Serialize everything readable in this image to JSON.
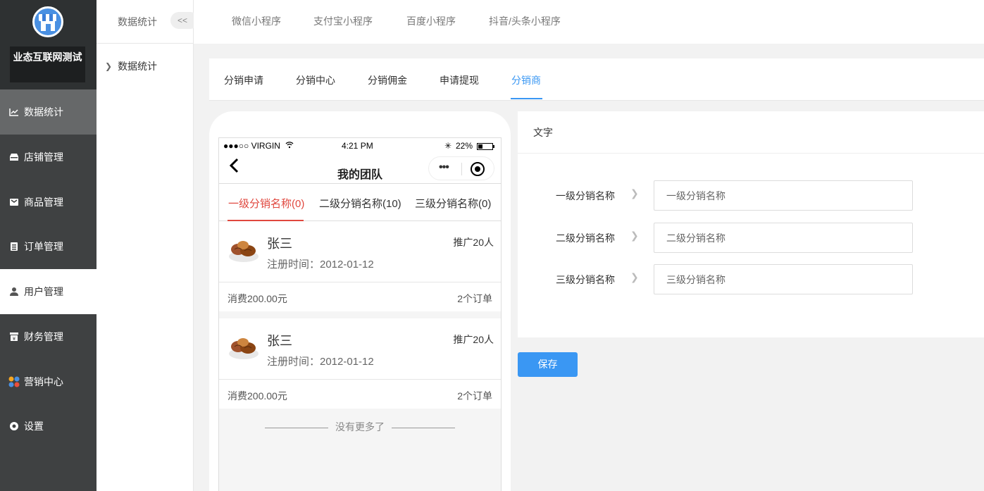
{
  "sidebar": {
    "brand": "业态互联网测试",
    "items": [
      {
        "label": "数据统计",
        "icon": "chart-icon"
      },
      {
        "label": "店铺管理",
        "icon": "store-icon"
      },
      {
        "label": "商品管理",
        "icon": "goods-icon"
      },
      {
        "label": "订单管理",
        "icon": "order-icon"
      },
      {
        "label": "用户管理",
        "icon": "user-icon"
      },
      {
        "label": "财务管理",
        "icon": "finance-icon"
      },
      {
        "label": "营销中心",
        "icon": "marketing-icon"
      },
      {
        "label": "设置",
        "icon": "settings-icon"
      }
    ]
  },
  "subside": {
    "title": "数据统计",
    "collapse": "<<",
    "item": "数据统计"
  },
  "top_tabs": [
    "微信小程序",
    "支付宝小程序",
    "百度小程序",
    "抖音/头条小程序"
  ],
  "sub_tabs": [
    "分销申请",
    "分销中心",
    "分销佣金",
    "申请提现",
    "分销商"
  ],
  "sub_tabs_active": "分销商",
  "phone": {
    "carrier": "●●●○○ VIRGIN",
    "time": "4:21 PM",
    "battery": "22%",
    "title": "我的团队",
    "level_tabs": [
      "一级分销名称(0)",
      "二级分销名称(10)",
      "三级分销名称(0)"
    ],
    "members": [
      {
        "name": "张三",
        "promo": "推广20人",
        "reg": "注册时间：2012-01-12",
        "spend": "消费200.00元",
        "orders": "2个订单"
      },
      {
        "name": "张三",
        "promo": "推广20人",
        "reg": "注册时间：2012-01-12",
        "spend": "消费200.00元",
        "orders": "2个订单"
      }
    ],
    "no_more": "没有更多了"
  },
  "form": {
    "header": "文字",
    "rows": [
      {
        "label": "一级分销名称",
        "placeholder": "一级分销名称"
      },
      {
        "label": "二级分销名称",
        "placeholder": "二级分销名称"
      },
      {
        "label": "三级分销名称",
        "placeholder": "三级分销名称"
      }
    ],
    "save": "保存"
  },
  "colors": {
    "accent": "#3a97f3",
    "active_red": "#e0473e",
    "sidebar": "#3f4142"
  }
}
